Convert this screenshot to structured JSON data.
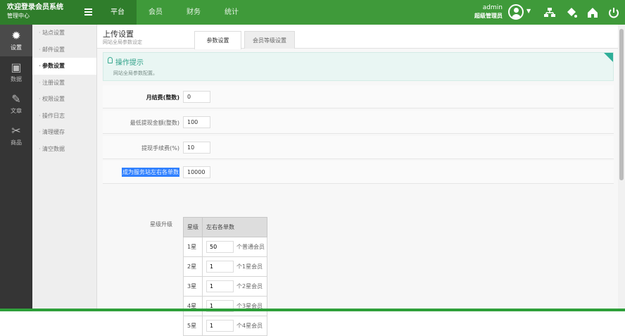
{
  "app": {
    "brand_title": "欢迎登录会员系统",
    "brand_subtitle": "管理中心"
  },
  "top_nav": [
    {
      "label": "平台",
      "active": true
    },
    {
      "label": "会员",
      "active": false
    },
    {
      "label": "财务",
      "active": false
    },
    {
      "label": "统计",
      "active": false
    }
  ],
  "user": {
    "name": "admin",
    "role": "超级管理员"
  },
  "toolbar_icons": [
    "sitemap-icon",
    "paint-bucket-icon",
    "home-icon",
    "power-icon"
  ],
  "left_rail": [
    {
      "label": "设置",
      "icon": "gear-icon",
      "active": true
    },
    {
      "label": "数据",
      "icon": "database-icon",
      "active": false
    },
    {
      "label": "文章",
      "icon": "pen-icon",
      "active": false
    },
    {
      "label": "商品",
      "icon": "tools-icon",
      "active": false
    }
  ],
  "sub_nav": [
    {
      "label": "站点设置",
      "active": false
    },
    {
      "label": "邮件设置",
      "active": false
    },
    {
      "label": "参数设置",
      "active": true
    },
    {
      "label": "注册设置",
      "active": false
    },
    {
      "label": "权限设置",
      "active": false
    },
    {
      "label": "操作日志",
      "active": false
    },
    {
      "label": "清理缓存",
      "active": false
    },
    {
      "label": "清空数据",
      "active": false
    }
  ],
  "page": {
    "title": "上传设置",
    "description": "网站全局参数设定",
    "tabs": [
      {
        "label": "参数设置",
        "active": true
      },
      {
        "label": "会员等级设置",
        "active": false
      }
    ]
  },
  "notice": {
    "title": "操作提示",
    "text": "网站全局参数配置。"
  },
  "settings": [
    {
      "label": "月结费(整数)",
      "value": "0",
      "style": "bold"
    },
    {
      "label": "最低提现金额(整数)",
      "value": "100",
      "style": "normal"
    },
    {
      "label": "提现手续费(%)",
      "value": "10",
      "style": "normal"
    },
    {
      "label": "成为服务站左右各单数",
      "value": "10000",
      "style": "selected"
    }
  ],
  "level_upgrade": {
    "label": "星级升级",
    "headers": [
      "星级",
      "左右各单数"
    ],
    "rows": [
      {
        "level": "1星",
        "value": "50",
        "suffix": "个普通会员"
      },
      {
        "level": "2星",
        "value": "1",
        "suffix": "个1星会员"
      },
      {
        "level": "3星",
        "value": "1",
        "suffix": "个2星会员"
      },
      {
        "level": "4星",
        "value": "1",
        "suffix": "个3星会员"
      },
      {
        "level": "5星",
        "value": "1",
        "suffix": "个4星会员"
      }
    ]
  },
  "colors": {
    "topbar": "#3f9a3a",
    "accent": "#2f7d2b",
    "rail": "#353535",
    "notice": "#e9f6f3"
  }
}
